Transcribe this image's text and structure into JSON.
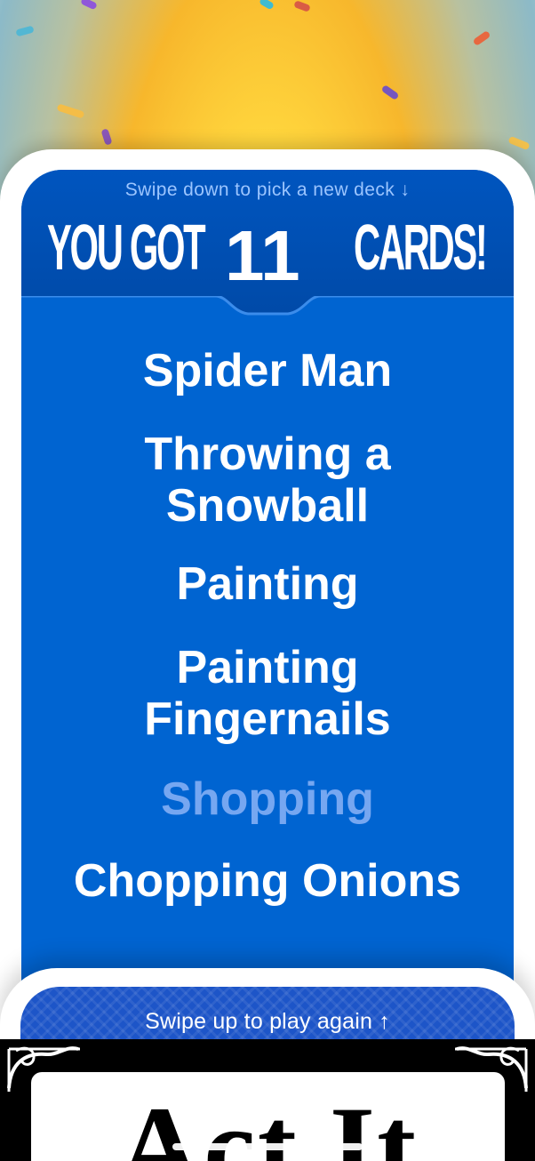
{
  "screen": {
    "instructions": {
      "top": "Swipe down to pick a new deck ↓",
      "bottom": "Swipe up to play again ↑"
    },
    "result": {
      "prefix": "YOU GOT",
      "count": "11",
      "suffix": "CARDS!"
    },
    "cards": [
      {
        "text": "Spider Man",
        "state": "got"
      },
      {
        "text": "Throwing a Snowball",
        "state": "got"
      },
      {
        "text": "Painting",
        "state": "got"
      },
      {
        "text": "Painting Fingernails",
        "state": "got"
      },
      {
        "text": "Shopping",
        "state": "missed"
      },
      {
        "text": "Chopping Onions",
        "state": "got"
      }
    ],
    "next_deck": {
      "title": "Act It"
    }
  },
  "colors": {
    "primary_blue": "#0064d1",
    "header_blue": "#004aa8",
    "missed_text": "#76a7f1",
    "background_yellow": "#ffd63d"
  },
  "icons": {
    "down_arrow": "down-arrow-icon",
    "up_arrow": "up-arrow-icon",
    "deck_ornament": "ornament-icon"
  }
}
